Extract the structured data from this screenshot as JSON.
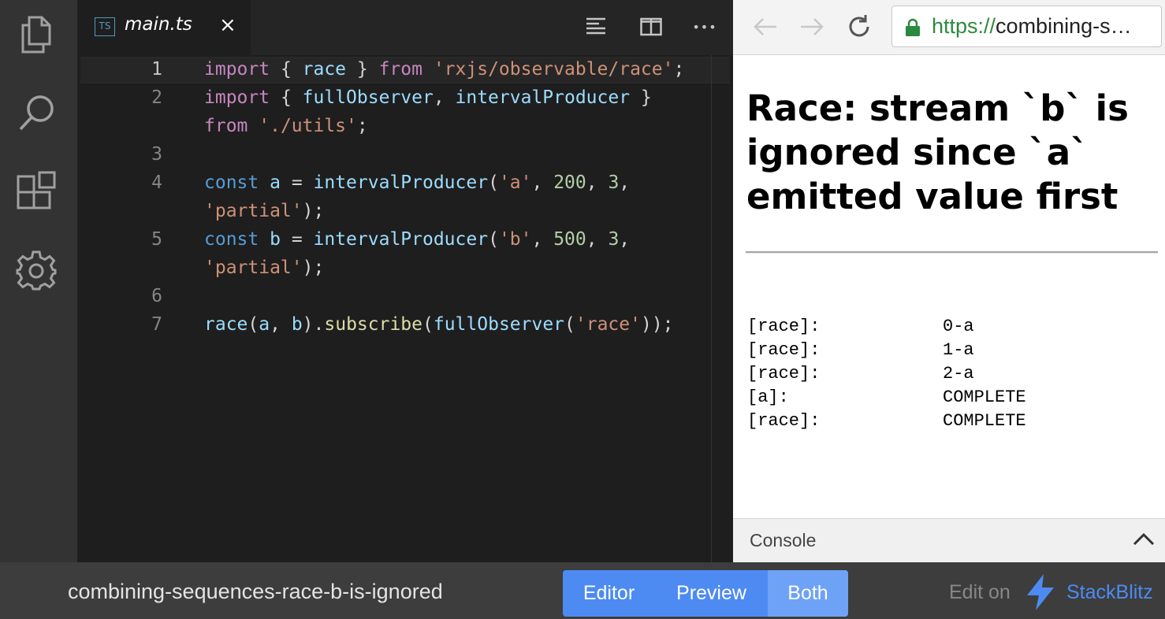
{
  "activity_bar": {
    "items": [
      {
        "icon": "files-icon"
      },
      {
        "icon": "search-icon"
      },
      {
        "icon": "extensions-icon"
      },
      {
        "icon": "settings-gear-icon"
      }
    ]
  },
  "editor": {
    "tab": {
      "badge": "TS",
      "filename": "main.ts",
      "close_glyph": "×"
    },
    "toolbar": {
      "more_glyph": "•••"
    },
    "line_numbers": [
      "1",
      "2",
      "3",
      "4",
      "5",
      "6",
      "7"
    ],
    "code": {
      "l1": {
        "kw1": "import",
        "p1": " { ",
        "v1": "race",
        "p2": " } ",
        "kw2": "from",
        "p3": " ",
        "s1": "'rxjs/observable/race'",
        "p4": ";"
      },
      "l2a": {
        "kw1": "import",
        "p1": " { ",
        "v1": "fullObserver",
        "p2": ", ",
        "v2": "intervalProducer",
        "p3": " }"
      },
      "l2b": {
        "kw1": "from",
        "p1": " ",
        "s1": "'./utils'",
        "p2": ";"
      },
      "l4a": {
        "kb1": "const",
        "p1": " ",
        "v1": "a",
        "p2": " = ",
        "f1": "intervalProducer",
        "p3": "(",
        "s1": "'a'",
        "p4": ", ",
        "n1": "200",
        "p5": ", ",
        "n2": "3",
        "p6": ","
      },
      "l4b": {
        "s1": "'partial'",
        "p1": ");"
      },
      "l5a": {
        "kb1": "const",
        "p1": " ",
        "v1": "b",
        "p2": " = ",
        "f1": "intervalProducer",
        "p3": "(",
        "s1": "'b'",
        "p4": ", ",
        "n1": "500",
        "p5": ", ",
        "n2": "3",
        "p6": ","
      },
      "l5b": {
        "s1": "'partial'",
        "p1": ");"
      },
      "l7": {
        "f1": "race",
        "p1": "(",
        "v1": "a",
        "p2": ", ",
        "v2": "b",
        "p3": ").",
        "f2": "subscribe",
        "p4": "(",
        "f3": "fullObserver",
        "p5": "(",
        "s1": "'race'",
        "p6": "));"
      }
    }
  },
  "browser": {
    "url": {
      "protocol": "https://",
      "host": "combining-s…"
    },
    "heading": "Race: stream `b` is ignored since `a` emitted value first",
    "log": [
      {
        "key": "[race]:",
        "value": "0-a"
      },
      {
        "key": "[race]:",
        "value": "1-a"
      },
      {
        "key": "[race]:",
        "value": "2-a"
      },
      {
        "key": "[a]:",
        "value": "COMPLETE"
      },
      {
        "key": "[race]:",
        "value": "COMPLETE"
      }
    ],
    "console_label": "Console"
  },
  "bottom_bar": {
    "project_name": "combining-sequences-race-b-is-ignored",
    "view_modes": [
      "Editor",
      "Preview",
      "Both"
    ],
    "active_view_mode": "Both",
    "edit_on_label": "Edit on",
    "brand_name": "StackBlitz",
    "brand_color": "#4d8bf2"
  }
}
